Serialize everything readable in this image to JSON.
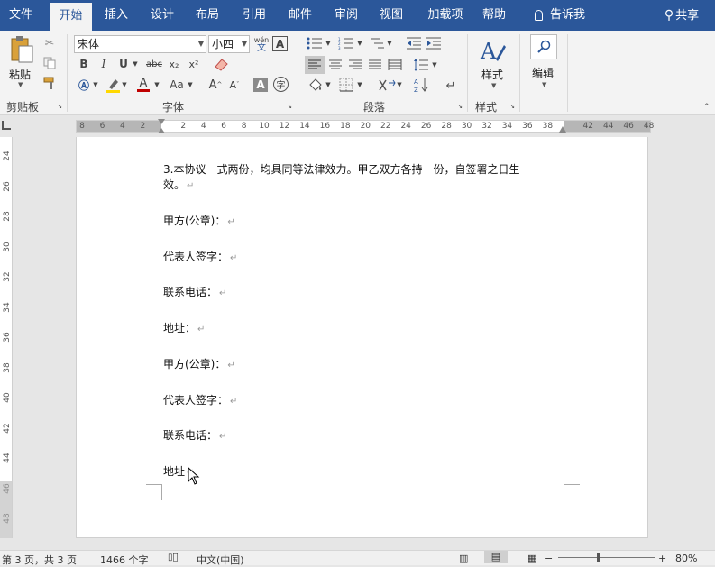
{
  "tabs": [
    "文件",
    "开始",
    "插入",
    "设计",
    "布局",
    "引用",
    "邮件",
    "审阅",
    "视图",
    "加载项",
    "帮助"
  ],
  "tell_me": "告诉我",
  "share": "共享",
  "ribbon": {
    "paste_label": "粘贴",
    "font_name": "宋体",
    "font_size": "小四",
    "pinyin_label": "wén",
    "bold": "B",
    "italic": "I",
    "underline": "U",
    "strike": "abc",
    "sub": "x₂",
    "sup": "x²",
    "font_color_a": "A",
    "change_case": "Aa",
    "grow": "A",
    "shrink": "A",
    "char_border": "A",
    "enclose": "字",
    "styles_label": "样式",
    "edit_label": "编辑",
    "groups": {
      "clipboard": "剪贴板",
      "font": "字体",
      "paragraph": "段落",
      "styles": "样式"
    }
  },
  "ruler": {
    "ticks": [
      "8",
      "6",
      "4",
      "2",
      "",
      "2",
      "4",
      "6",
      "8",
      "10",
      "12",
      "14",
      "16",
      "18",
      "20",
      "22",
      "24",
      "26",
      "28",
      "30",
      "32",
      "34",
      "36",
      "38",
      "",
      "42",
      "44",
      "46",
      "48"
    ],
    "vticks": [
      "24",
      "26",
      "28",
      "30",
      "32",
      "34",
      "36",
      "38",
      "40",
      "42",
      "44",
      "46",
      "48"
    ]
  },
  "document": {
    "lines": [
      "3.本协议一式两份，均具同等法律效力。甲乙双方各持一份，自签署之日生",
      "效。",
      "甲方(公章)：",
      "代表人签字：",
      "联系电话：",
      "地址：",
      "甲方(公章)：",
      "代表人签字：",
      "联系电话：",
      "地址"
    ]
  },
  "statusbar": {
    "page": "第 3 页，共 3 页",
    "words": "1466 个字",
    "language": "中文(中国)",
    "zoom": "80%"
  },
  "colors": {
    "title_bar": "#2b579a",
    "ribbon_bg": "#f3f3f3",
    "highlight": "#ffd800",
    "font_color": "#c00000"
  }
}
